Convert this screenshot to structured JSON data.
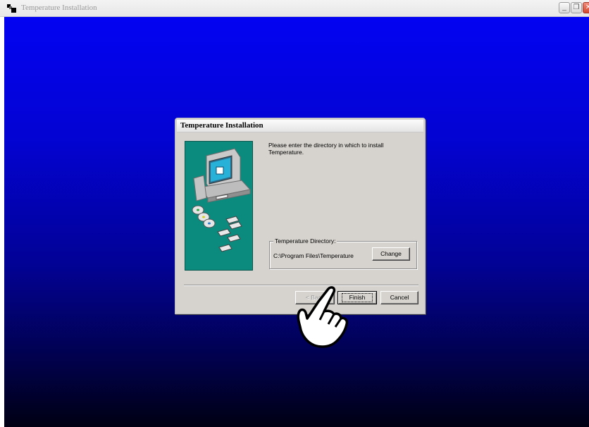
{
  "window": {
    "title": "Temperature Installation",
    "controls": {
      "minimize": "_",
      "restore": "❐",
      "close": "✕"
    }
  },
  "dialog": {
    "title": "Temperature Installation",
    "prompt": "Please enter the directory in which to install Temperature.",
    "group_label": "Temperature Directory:",
    "directory_path": "C:\\Program Files\\Temperature",
    "change_label": "Change",
    "back_label": "< Back",
    "finish_label": "Finish",
    "cancel_label": "Cancel"
  },
  "colors": {
    "desktop_top": "#0303f2",
    "desktop_bottom": "#000013",
    "dialog_face": "#d6d3ce",
    "art_background": "#0b8a7e"
  },
  "icons": {
    "app": "app-icon",
    "illustration": "computer-install-illustration",
    "pointer": "hand-pointer-icon"
  }
}
